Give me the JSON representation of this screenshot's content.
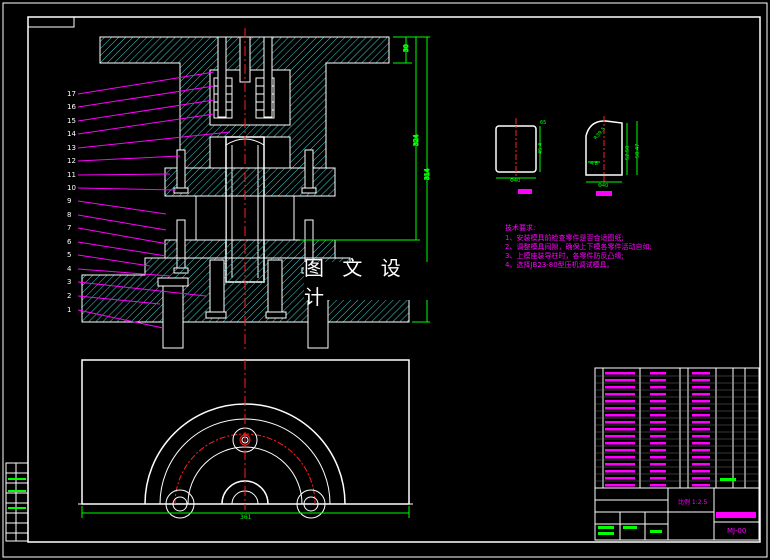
{
  "drawing": {
    "watermark": "图 文 设 计",
    "drawing_code": "MJ-00",
    "scale_note": "比例 1:2.5",
    "colors": {
      "background": "#000000",
      "frame": "#ffffff",
      "hatch": "#3fd0d0",
      "leader": "#ff00ff",
      "dimension": "#00ff00",
      "centerline": "#ff2020",
      "part": "#ffffff",
      "title_fill": "#ff00ff"
    },
    "balloons": [
      "17",
      "16",
      "15",
      "14",
      "13",
      "12",
      "11",
      "10",
      "9",
      "8",
      "7",
      "6",
      "5",
      "4",
      "3",
      "2",
      "1"
    ],
    "dimensions": {
      "plate_height": "30",
      "total_height": "324",
      "overall_height": "314",
      "base_width": "361",
      "detail_a_width": "Φ40",
      "detail_a_height": "45.4",
      "detail_a_top": "65",
      "detail_b_width": "Φ40",
      "detail_b_radius": "R39.5",
      "detail_b_h1": "52.50",
      "detail_b_h2": "50.47",
      "detail_b_angle": "4.8"
    },
    "technical_requirements": {
      "title": "技术要求:",
      "items": [
        "1、安装模具前检查零件是否合适图纸;",
        "2、调整模具间隙，确保上下模各零件活动自如;",
        "3、上模座装导柱时，各零件防反凸缘;",
        "4、选择JB23-80型压机调试模具。"
      ]
    }
  }
}
